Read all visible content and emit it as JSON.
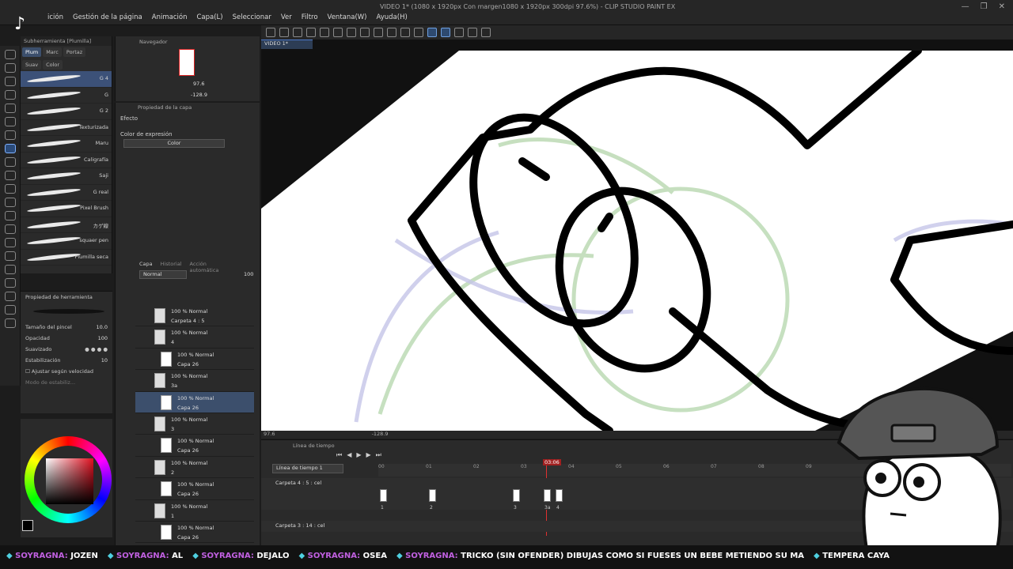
{
  "app": {
    "title": "VIDEO 1* (1080 x 1920px Con margen1080 x 1920px 300dpi 97.6%) - CLIP STUDIO PAINT EX",
    "menu": [
      "ición",
      "Gestión de la página",
      "Animación",
      "Capa(L)",
      "Seleccionar",
      "Ver",
      "Filtro",
      "Ventana(W)",
      "Ayuda(H)"
    ],
    "doc_tab": "VIDEO 1*"
  },
  "subtool": {
    "header": "Subherramienta [Plumilla]",
    "tabs": [
      "Plum",
      "Marc",
      "Portaz"
    ],
    "tabs2": [
      "Suav",
      "Color"
    ],
    "brushes": [
      {
        "name": "G 4",
        "selected": true
      },
      {
        "name": "G"
      },
      {
        "name": "G 2"
      },
      {
        "name": "Texturizada"
      },
      {
        "name": "Maru"
      },
      {
        "name": "Caligrafía"
      },
      {
        "name": "Saji"
      },
      {
        "name": "G real"
      },
      {
        "name": "Pixel Brush"
      },
      {
        "name": "カゲ線"
      },
      {
        "name": "squaer pen"
      },
      {
        "name": "Plumilla seca"
      }
    ]
  },
  "toolprop": {
    "header": "Propiedad de herramienta",
    "brush_size_label": "Tamaño del pincel",
    "brush_size": "10.0",
    "opacity_label": "Opacidad",
    "opacity": "100",
    "smoothing_label": "Suavizado",
    "stabilization_label": "Estabilización",
    "stabilization": "10",
    "speed_label": "Ajustar según velocidad",
    "drawing_mode": "Modo de estabiliz..."
  },
  "navigator": {
    "title": "Navegador",
    "zoom": "97.6",
    "angle": "-128.9"
  },
  "layer_property": {
    "title": "Propiedad de la capa",
    "effect_label": "Efecto",
    "expression_label": "Color de expresión",
    "expression_value": "Color"
  },
  "layer_panel": {
    "tabs": [
      "Capa",
      "Historial",
      "Acción automática"
    ],
    "blend_mode": "Normal",
    "opacity": "100",
    "layers": [
      {
        "type": "folder",
        "l1": "100 % Normal",
        "l2": "Carpeta 4 : 5"
      },
      {
        "type": "folder",
        "l1": "100 % Normal",
        "l2": "4"
      },
      {
        "type": "layer",
        "l1": "100 % Normal",
        "l2": "Capa 26"
      },
      {
        "type": "folder",
        "l1": "100 % Normal",
        "l2": "3a"
      },
      {
        "type": "layer",
        "l1": "100 % Normal",
        "l2": "Capa 26",
        "selected": true
      },
      {
        "type": "folder",
        "l1": "100 % Normal",
        "l2": "3"
      },
      {
        "type": "layer",
        "l1": "100 % Normal",
        "l2": "Capa 26"
      },
      {
        "type": "folder",
        "l1": "100 % Normal",
        "l2": "2"
      },
      {
        "type": "layer",
        "l1": "100 % Normal",
        "l2": "Capa 26"
      },
      {
        "type": "folder",
        "l1": "100 % Normal",
        "l2": "1"
      },
      {
        "type": "layer",
        "l1": "100 % Normal",
        "l2": "Capa 26"
      }
    ]
  },
  "canvas_status": {
    "zoom": "97.6",
    "angle": "-128.9"
  },
  "timeline": {
    "tab": "Línea de tiempo",
    "select": "Línea de tiempo 1",
    "ticks": [
      "00",
      "01",
      "02",
      "03",
      "04",
      "05",
      "06",
      "07",
      "08",
      "09"
    ],
    "playhead_label": "03:06",
    "track1": "Carpeta 4 : 5 : cel",
    "track2": "Carpeta 3 : 14 : cel",
    "cel_labels": [
      "1",
      "2",
      "3",
      "3a",
      "4"
    ]
  },
  "ticker": [
    {
      "user": "SOYRAGNA:",
      "msg": "JOZEN"
    },
    {
      "user": "SOYRAGNA:",
      "msg": "AL"
    },
    {
      "user": "SOYRAGNA:",
      "msg": "DEJALO"
    },
    {
      "user": "SOYRAGNA:",
      "msg": "OSEA"
    },
    {
      "user": "SOYRAGNA:",
      "msg": "TRICKO (SIN OFENDER) DIBUJAS COMO SI FUESES UN BEBE METIENDO SU MA"
    },
    {
      "user": "",
      "msg": "TEMPERA CAYA"
    }
  ],
  "colors": {
    "accent": "#4d7acb",
    "selected": "#3c4f6c",
    "panel": "#2a2a2a",
    "playhead": "#e03030",
    "chat_user": "#c060e0",
    "chat_badge": "#4fd0e0"
  }
}
